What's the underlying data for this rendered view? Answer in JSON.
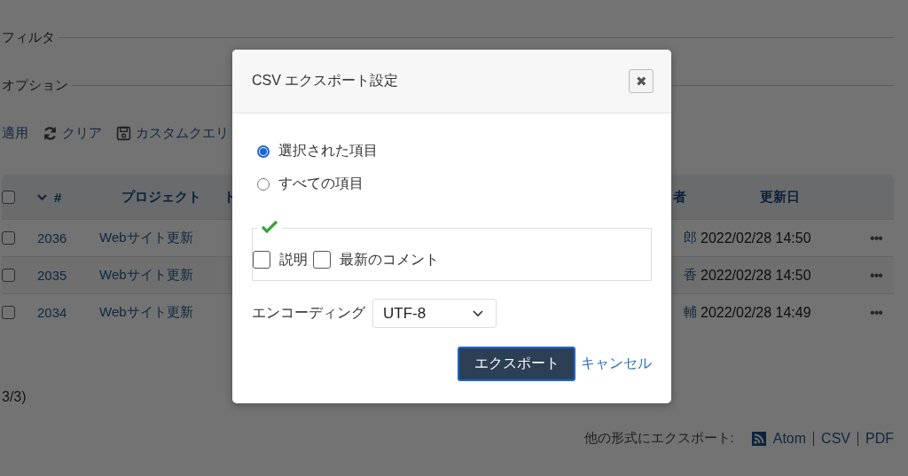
{
  "page": {
    "sections": [
      {
        "label": "フィルタ"
      },
      {
        "label": "オプション"
      }
    ],
    "actions": [
      {
        "kind": "apply",
        "label": "適用"
      },
      {
        "kind": "clear",
        "label": "クリア"
      },
      {
        "kind": "save",
        "label": "カスタムクエリ"
      }
    ],
    "table": {
      "select_all": {
        "checked": false
      },
      "columns": [
        {
          "label": "#",
          "sorted": true
        },
        {
          "label": "プロジェクト",
          "sorted": false
        },
        {
          "label": "ト",
          "sorted": false
        },
        {
          "label": "者",
          "sorted": false
        },
        {
          "label": "更新日",
          "sorted": false
        }
      ],
      "rows": [
        {
          "checked": false,
          "id": "2036",
          "project": "Webサイト更新",
          "column_4": "郎",
          "updated": "2022/02/28 14:50",
          "menu": "•••"
        },
        {
          "checked": false,
          "id": "2035",
          "project": "Webサイト更新",
          "column_4": "香",
          "updated": "2022/02/28 14:50",
          "menu": "•••"
        },
        {
          "checked": false,
          "id": "2034",
          "project": "Webサイト更新",
          "column_4": "輔",
          "updated": "2022/02/28 14:49",
          "menu": "•••"
        }
      ]
    },
    "pagination": "3/3)",
    "export": {
      "label": "他の形式にエクスポート:",
      "links": [
        "Atom",
        "CSV",
        "PDF"
      ]
    }
  },
  "modal": {
    "title": "CSV エクスポート設定",
    "close": "✖",
    "scope": [
      {
        "label": "選択された項目",
        "selected": true
      },
      {
        "label": "すべての項目",
        "selected": false
      }
    ],
    "columns": [
      {
        "label": "説明",
        "checked": false
      },
      {
        "label": "最新のコメント",
        "checked": false
      }
    ],
    "encoding": {
      "label": "エンコーディング",
      "value": "UTF-8"
    },
    "submit": "エクスポート",
    "cancel": "キャンセル"
  }
}
